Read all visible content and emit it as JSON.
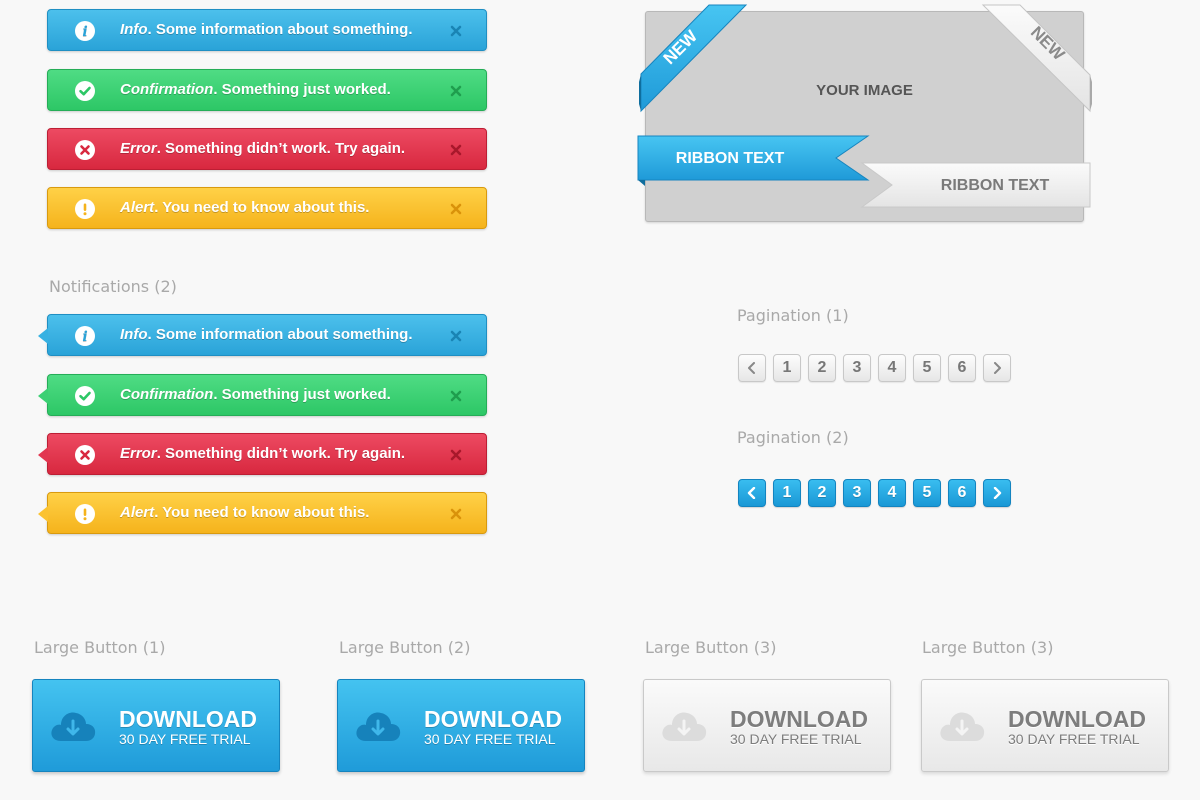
{
  "notifications_1": [
    {
      "type": "info",
      "title": "Info",
      "message": ". Some information about something."
    },
    {
      "type": "confirmation",
      "title": "Confirmation",
      "message": ". Something just worked."
    },
    {
      "type": "error",
      "title": "Error",
      "message": ". Something didn’t work. Try again."
    },
    {
      "type": "alert",
      "title": "Alert",
      "message": ". You need to know about this."
    }
  ],
  "notifications_2": {
    "label": "Notifications (2)",
    "items": [
      {
        "type": "info",
        "title": "Info",
        "message": ". Some information about something."
      },
      {
        "type": "confirmation",
        "title": "Confirmation",
        "message": ". Something just worked."
      },
      {
        "type": "error",
        "title": "Error",
        "message": ". Something didn’t work. Try again."
      },
      {
        "type": "alert",
        "title": "Alert",
        "message": ". You need to know about this."
      }
    ]
  },
  "ribbons": {
    "image_placeholder": "YOUR IMAGE",
    "corner_left": "NEW",
    "corner_right": "NEW",
    "ribbon_blue": "RIBBON TEXT",
    "ribbon_grey": "RIBBON TEXT"
  },
  "pagination_1": {
    "label": "Pagination (1)",
    "pages": [
      "1",
      "2",
      "3",
      "4",
      "5",
      "6"
    ]
  },
  "pagination_2": {
    "label": "Pagination (2)",
    "pages": [
      "1",
      "2",
      "3",
      "4",
      "5",
      "6"
    ]
  },
  "large_buttons": [
    {
      "label": "Large Button (1)",
      "title": "DOWNLOAD",
      "subtitle": "30 DAY FREE TRIAL",
      "style": "blue"
    },
    {
      "label": "Large Button (2)",
      "title": "DOWNLOAD",
      "subtitle": "30 DAY FREE TRIAL",
      "style": "blue"
    },
    {
      "label": "Large Button (3)",
      "title": "DOWNLOAD",
      "subtitle": "30 DAY FREE TRIAL",
      "style": "grey"
    },
    {
      "label": "Large Button (3)",
      "title": "DOWNLOAD",
      "subtitle": "30 DAY FREE TRIAL",
      "style": "grey"
    }
  ],
  "colors": {
    "info": "#2aa3d8",
    "confirmation": "#2dc766",
    "error": "#d8283f",
    "alert": "#f5b31c",
    "accent_blue": "#1a98d6",
    "neutral_grey": "#e8e8e8"
  },
  "icons": {
    "info": "info-circle-icon",
    "confirmation": "check-circle-icon",
    "error": "x-circle-icon",
    "alert": "exclamation-circle-icon",
    "close": "close-icon",
    "prev": "chevron-left-icon",
    "next": "chevron-right-icon",
    "download": "cloud-download-icon"
  }
}
